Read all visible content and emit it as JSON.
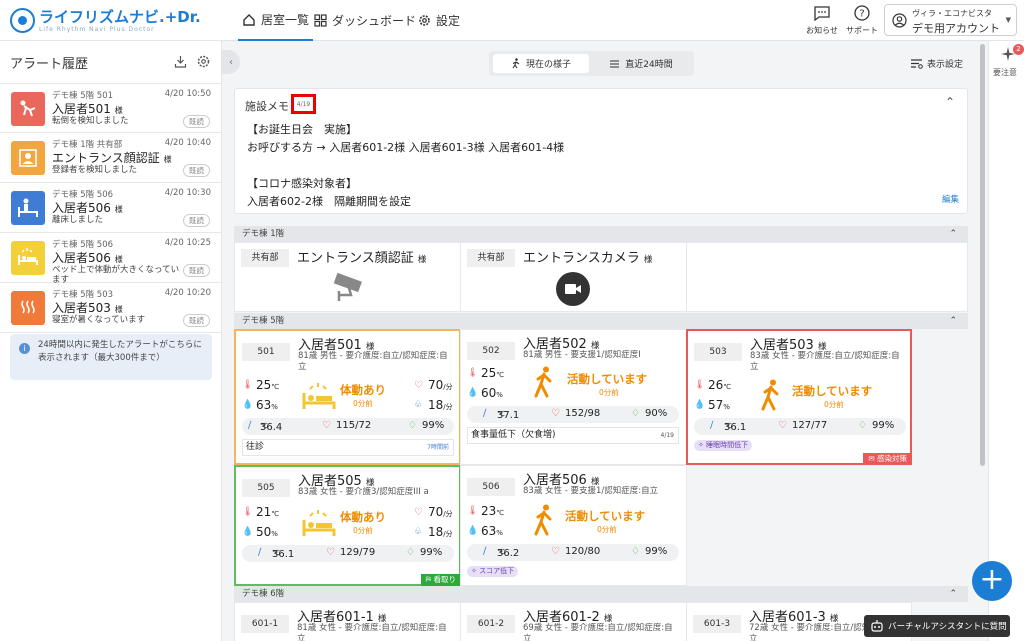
{
  "app": {
    "logo": "ライフリズムナビ.+Dr.",
    "logo_sub": "Life Rhythm Navi Plus Doctor"
  },
  "nav": [
    {
      "label": "居室一覧",
      "active": true
    },
    {
      "label": "ダッシュボード",
      "active": false
    },
    {
      "label": "設定",
      "active": false
    }
  ],
  "header": {
    "notify": "お知らせ",
    "support": "サポート",
    "account_small": "ヴィラ・エコナビスタ",
    "account_name": "デモ用アカウント"
  },
  "sidebar": {
    "title": "アラート履歴",
    "read_label": "既読",
    "alerts": [
      {
        "loc": "デモ棟 5階 501",
        "time": "4/20 10:50",
        "name": "入居者501",
        "honor": "様",
        "desc": "転倒を検知しました",
        "color": "#e9685b",
        "icon": "fall-icon"
      },
      {
        "loc": "デモ棟 1階 共有部",
        "time": "4/20 10:40",
        "name": "エントランス顔認証",
        "honor": "様",
        "desc": "登録者を検知しました",
        "color": "#f3a53f",
        "icon": "face-id-icon"
      },
      {
        "loc": "デモ棟 5階 506",
        "time": "4/20 10:30",
        "name": "入居者506",
        "honor": "様",
        "desc": "離床しました",
        "color": "#3f7cd4",
        "icon": "leave-bed-icon"
      },
      {
        "loc": "デモ棟 5階 506",
        "time": "4/20 10:25",
        "name": "入居者506",
        "honor": "様",
        "desc": "ベッド上で体動が大きくなっています",
        "color": "#f3cf3a",
        "icon": "bed-motion-icon"
      },
      {
        "loc": "デモ棟 5階 503",
        "time": "4/20 10:20",
        "name": "入居者503",
        "honor": "様",
        "desc": "寝室が暑くなっています",
        "color": "#f07a3a",
        "icon": "hot-room-icon"
      }
    ],
    "info": "24時間以内に発生したアラートがこちらに表示されます（最大300件まで）"
  },
  "view": {
    "current": "現在の様子",
    "last24": "直近24時間",
    "display_settings": "表示設定"
  },
  "memo": {
    "title": "施設メモ",
    "date": "4/19",
    "lines": [
      "【お誕生日会　実施】",
      "お呼びする方 → 入居者601-2様 入居者601-3様 入居者601-4様",
      "",
      "【コロナ感染対象者】",
      "入居者602-2様　隔離期間を設定"
    ],
    "edit": "編集"
  },
  "sections": {
    "f1": "デモ棟 1階",
    "f5": "デモ棟 5階",
    "f6": "デモ棟 6階"
  },
  "shared": [
    {
      "tag": "共有部",
      "name": "エントランス顔認証",
      "honor": "様"
    },
    {
      "tag": "共有部",
      "name": "エントランスカメラ",
      "honor": "様"
    }
  ],
  "rooms": {
    "r501": {
      "room": "501",
      "name": "入居者501",
      "honor": "様",
      "info": "81歳 男性 - 要介護度:自立/認知症度:自立",
      "temp": "25",
      "hum": "63",
      "status": "体動あり",
      "ago": "0分前",
      "hr": "70",
      "rr": "18",
      "bt": "36.4",
      "bp": "115/72",
      "spo2": "99%",
      "note": "往診",
      "note_date": "7時間前"
    },
    "r502": {
      "room": "502",
      "name": "入居者502",
      "honor": "様",
      "info": "81歳 男性 - 要支援1/認知症度I",
      "temp": "25",
      "hum": "60",
      "status": "活動しています",
      "ago": "0分前",
      "bt": "37.1",
      "bp": "152/98",
      "spo2": "90%",
      "note": "食事量低下（欠食増)",
      "note_date": "4/19"
    },
    "r503": {
      "room": "503",
      "name": "入居者503",
      "honor": "様",
      "info": "83歳 女性 - 要介護度:自立/認知症度:自立",
      "temp": "26",
      "hum": "57",
      "status": "活動しています",
      "ago": "0分前",
      "bt": "36.1",
      "bp": "127/77",
      "spo2": "99%",
      "tag": "睡眠時間低下",
      "corner": "感染対策"
    },
    "r505": {
      "room": "505",
      "name": "入居者505",
      "honor": "様",
      "info": "83歳 女性 - 要介護3/認知症度III a",
      "temp": "21",
      "hum": "50",
      "status": "体動あり",
      "ago": "0分前",
      "hr": "70",
      "rr": "18",
      "bt": "36.1",
      "bp": "129/79",
      "spo2": "99%",
      "corner": "看取り"
    },
    "r506": {
      "room": "506",
      "name": "入居者506",
      "honor": "様",
      "info": "83歳 女性 - 要支援1/認知症度:自立",
      "temp": "23",
      "hum": "63",
      "status": "活動しています",
      "ago": "0分前",
      "bt": "36.2",
      "bp": "120/80",
      "spo2": "99%",
      "tag": "スコア低下"
    },
    "r6011": {
      "room": "601-1",
      "name": "入居者601-1",
      "honor": "様",
      "info": "81歳 女性 - 要介護度:自立/認知症度:自立"
    },
    "r6012": {
      "room": "601-2",
      "name": "入居者601-2",
      "honor": "様",
      "info": "69歳 女性 - 要介護度:自立/認知症度:自立"
    },
    "r6013": {
      "room": "601-3",
      "name": "入居者601-3",
      "honor": "様",
      "info": "72歳 女性 - 要介護度:自立/認知症度:自立"
    }
  },
  "units": {
    "c": "℃",
    "pct": "%",
    "bpm": "/分"
  },
  "rail": {
    "label": "要注意",
    "badge": "2"
  },
  "chat": "バーチャルアシスタントに質問"
}
